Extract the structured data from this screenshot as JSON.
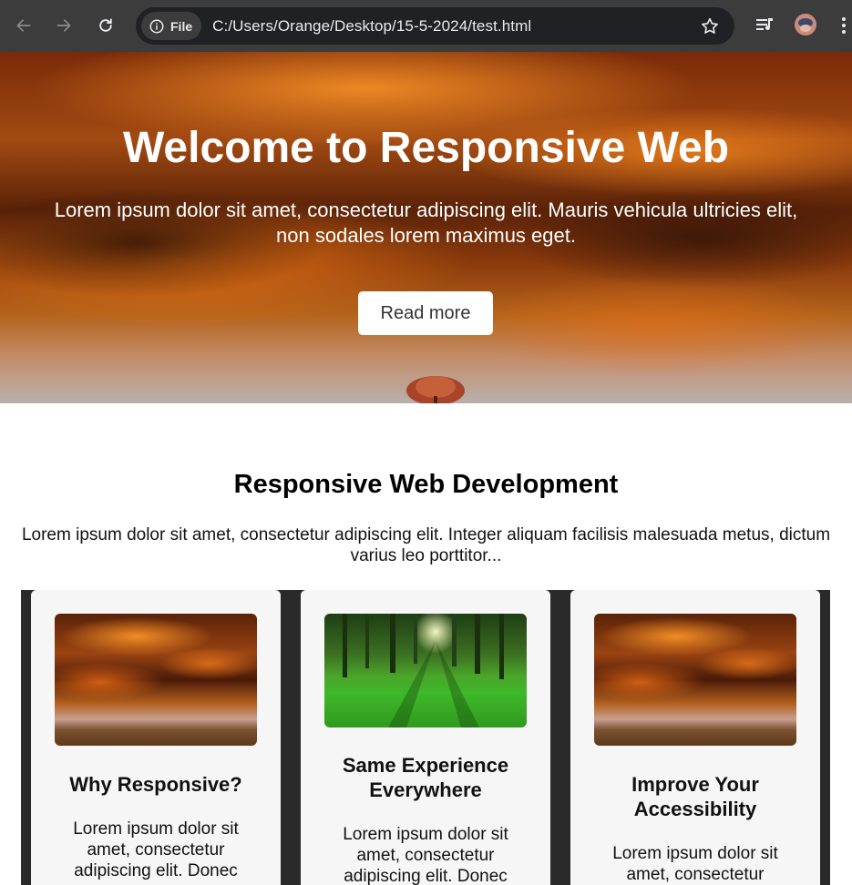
{
  "browser": {
    "chip_label": "File",
    "url": "C:/Users/Orange/Desktop/15-5-2024/test.html"
  },
  "hero": {
    "title": "Welcome to Responsive Web",
    "text": "Lorem ipsum dolor sit amet, consectetur adipiscing elit. Mauris vehicula ultricies elit, non sodales lorem maximus eget.",
    "button_label": "Read more"
  },
  "section": {
    "title": "Responsive Web Development",
    "text": "Lorem ipsum dolor sit amet, consectetur adipiscing elit. Integer aliquam facilisis malesuada metus, dictum varius leo porttitor..."
  },
  "cards": [
    {
      "title": "Why Responsive?",
      "text": "Lorem ipsum dolor sit amet, consectetur adipiscing elit. Donec"
    },
    {
      "title": "Same Experience Everywhere",
      "text": "Lorem ipsum dolor sit amet, consectetur adipiscing elit. Donec"
    },
    {
      "title": "Improve Your Accessibility",
      "text": "Lorem ipsum dolor sit amet, consectetur"
    }
  ],
  "colors": {
    "chrome": "#3c3c3c",
    "omnibox": "#202124",
    "card_bg": "#f6f6f6",
    "cards_container": "#2a2a2a"
  }
}
